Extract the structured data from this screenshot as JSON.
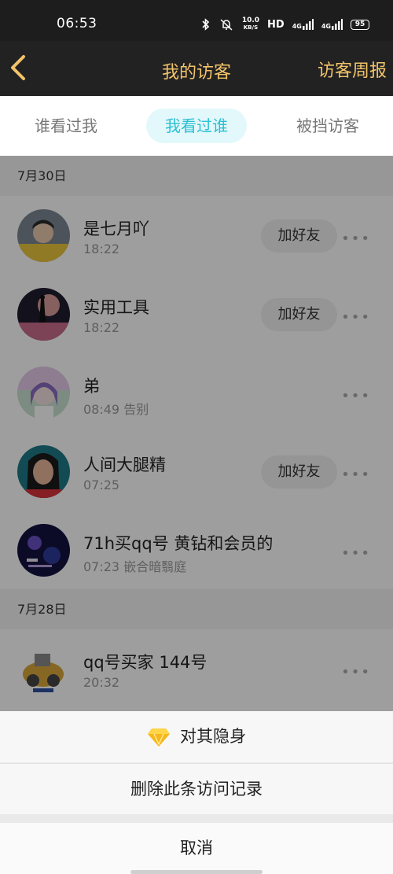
{
  "status_bar": {
    "time": "06:53",
    "speed": "10.0",
    "speed_unit": "KB/S",
    "hd": "HD",
    "net1": "4G",
    "net2": "4G",
    "battery": "95"
  },
  "header": {
    "title": "我的访客",
    "weekly_label": "访客周报",
    "accent_color": "#f3c46b"
  },
  "tabs": [
    {
      "label": "谁看过我",
      "active": false
    },
    {
      "label": "我看过谁",
      "active": true
    },
    {
      "label": "被挡访客",
      "active": false
    }
  ],
  "groups": [
    {
      "date": "7月30日",
      "items": [
        {
          "name": "是七月吖",
          "sub": "18:22",
          "add_label": "加好友",
          "avatar": "boy-in-yellow"
        },
        {
          "name": "实用工具",
          "sub": "18:22",
          "add_label": "加好友",
          "avatar": "night-scene"
        },
        {
          "name": "弟",
          "sub": "08:49 告别",
          "add_label": "",
          "avatar": "anime-girl"
        },
        {
          "name": "人间大腿精",
          "sub": "07:25",
          "add_label": "加好友",
          "avatar": "girl-portrait"
        },
        {
          "name": "71h买qq号 黄钻和会员的",
          "sub": "07:23 嵌合暗翳庭",
          "add_label": "",
          "avatar": "blue-poster"
        }
      ]
    },
    {
      "date": "7月28日",
      "items": [
        {
          "name": "qq号买家 144号",
          "sub": "20:32",
          "add_label": "",
          "avatar": "golden-machine"
        }
      ]
    }
  ],
  "more_glyph": "•••",
  "sheet": {
    "hide_label": "对其隐身",
    "delete_label": "删除此条访问记录",
    "cancel_label": "取消"
  }
}
